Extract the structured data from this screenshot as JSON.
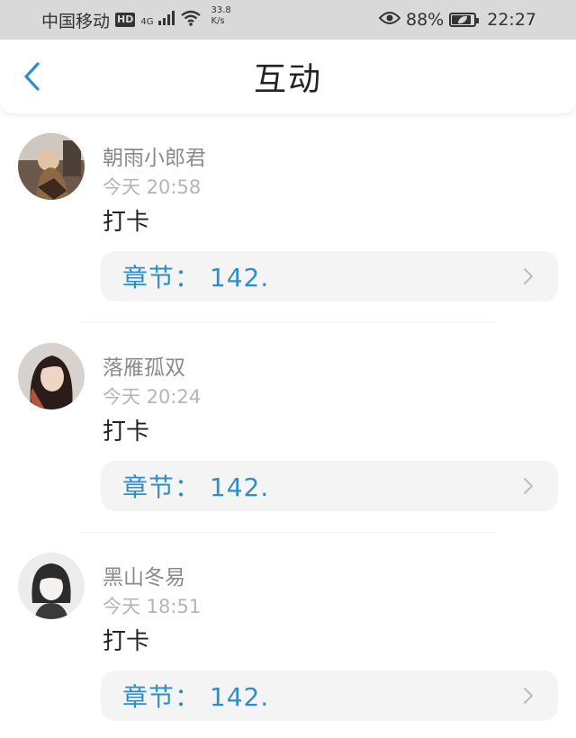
{
  "status_bar": {
    "carrier": "中国移动",
    "hd": "HD",
    "network": "4G",
    "speed_value": "33.8",
    "speed_unit": "K/s",
    "battery_percent": "88%",
    "battery_level": 0.88,
    "time": "22:27"
  },
  "header": {
    "title": "互动",
    "accent_color": "#2e8ec9"
  },
  "comments": [
    {
      "username": "朝雨小郎君",
      "time": "今天 20:58",
      "content": "打卡",
      "chapter": "章节： 142.",
      "avatar_icon": "user-avatar-icon"
    },
    {
      "username": "落雁孤双",
      "time": "今天 20:24",
      "content": "打卡",
      "chapter": "章节： 142.",
      "avatar_icon": "user-avatar-icon"
    },
    {
      "username": "黑山冬易",
      "time": "今天 18:51",
      "content": "打卡",
      "chapter": "章节： 142.",
      "avatar_icon": "user-avatar-icon"
    }
  ]
}
